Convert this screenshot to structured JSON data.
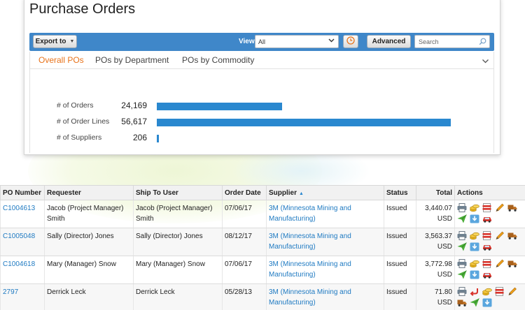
{
  "header": {
    "title": "Purchase Orders"
  },
  "toolbar": {
    "export_label": "Export to",
    "view_label": "View",
    "view_value": "All",
    "advanced_label": "Advanced",
    "search_placeholder": "Search"
  },
  "tabs": [
    {
      "label": "Overall POs",
      "active": true
    },
    {
      "label": "POs by Department",
      "active": false
    },
    {
      "label": "POs by Commodity",
      "active": false
    }
  ],
  "stats": [
    {
      "label": "# of Orders",
      "value": "24,169",
      "count": 24169
    },
    {
      "label": "# of Order Lines",
      "value": "56,617",
      "count": 56617
    },
    {
      "label": "# of Suppliers",
      "value": "206",
      "count": 206
    }
  ],
  "table": {
    "columns": [
      "PO Number",
      "Requester",
      "Ship To User",
      "Order Date",
      "Supplier",
      "Status",
      "Total",
      "Actions"
    ],
    "rows": [
      {
        "po_number": "C1004613",
        "requester": "Jacob (Project Manager) Smith",
        "ship_to": "Jacob (Project Manager) Smith",
        "order_date": "07/06/17",
        "supplier": "3M (Minnesota Mining and Manufacturing)",
        "status": "Issued",
        "total": "3,440.07",
        "currency": "USD"
      },
      {
        "po_number": "C1005048",
        "requester": "Sally (Director) Jones",
        "ship_to": "Sally (Director) Jones",
        "order_date": "08/12/17",
        "supplier": "3M (Minnesota Mining and Manufacturing)",
        "status": "Issued",
        "total": "3,563.37",
        "currency": "USD"
      },
      {
        "po_number": "C1004618",
        "requester": "Mary (Manager) Snow",
        "ship_to": "Mary (Manager) Snow",
        "order_date": "07/06/17",
        "supplier": "3M (Minnesota Mining and Manufacturing)",
        "status": "Issued",
        "total": "3,772.98",
        "currency": "USD"
      },
      {
        "po_number": "2797",
        "requester": "Derrick Leck",
        "ship_to": "Derrick Leck",
        "order_date": "05/28/13",
        "supplier": "3M (Minnesota Mining and Manufacturing)",
        "status": "Issued",
        "total": "71.80",
        "currency": "USD"
      }
    ]
  },
  "colors": {
    "toolbar_blue": "#3f87c9",
    "bar_blue": "#2a88cf",
    "active_tab": "#e8731b",
    "link": "#1f7ac2"
  },
  "icons": {
    "row_actions_a": [
      "printer-icon",
      "coins-icon",
      "pdf-icon",
      "pencil-icon",
      "truck-icon",
      "send-icon",
      "download-icon",
      "car-icon"
    ],
    "row_actions_b": [
      "printer-icon",
      "return-icon",
      "coins-icon",
      "pdf-icon",
      "pencil-icon",
      "truck-icon",
      "send-icon",
      "download-icon"
    ]
  }
}
